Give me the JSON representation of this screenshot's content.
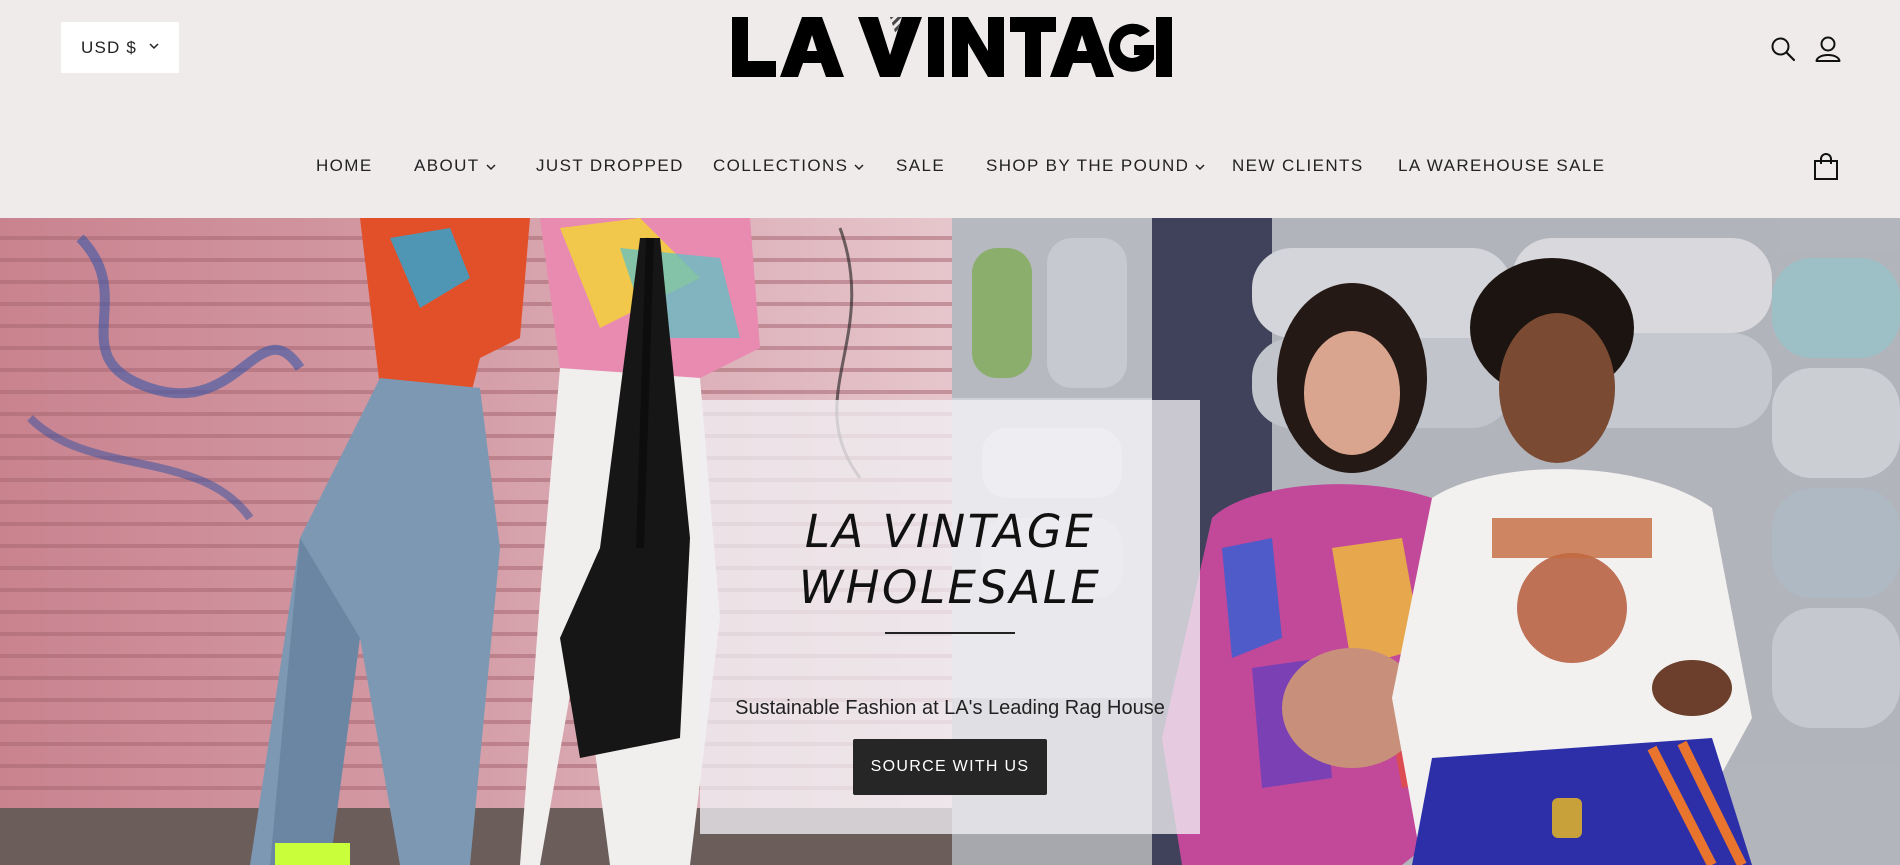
{
  "header": {
    "currency": {
      "label": "USD $"
    },
    "logo": {
      "text": "LA VINTAGE"
    },
    "icons": {
      "search": "search-icon",
      "account": "account-icon",
      "cart": "shopping-bag-icon"
    }
  },
  "nav": {
    "items": [
      {
        "label": "HOME"
      },
      {
        "label": "ABOUT",
        "has_dropdown": true
      },
      {
        "label": "JUST DROPPED"
      },
      {
        "label": "COLLECTIONS",
        "has_dropdown": true
      },
      {
        "label": "SALE"
      },
      {
        "label": "SHOP BY THE POUND",
        "has_dropdown": true
      },
      {
        "label": "NEW CLIENTS"
      },
      {
        "label": "LA WAREHOUSE SALE"
      }
    ]
  },
  "hero": {
    "title_line1": "LA VINTAGE",
    "title_line2": "WHOLESALE",
    "subtitle": "Sustainable Fashion at LA's Leading Rag House",
    "cta_label": "SOURCE WITH US"
  },
  "colors": {
    "page_bg": "#efebeb",
    "text": "#1b1b1b",
    "button_bg": "#262626",
    "overlay_bg": "rgba(240,238,242,0.78)"
  }
}
